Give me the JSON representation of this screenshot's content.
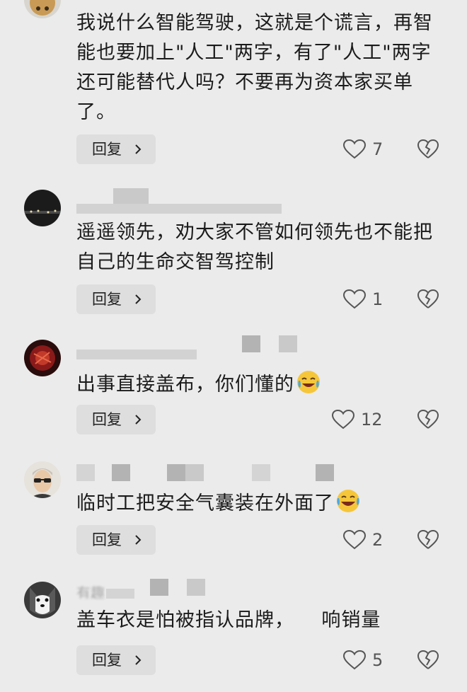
{
  "reply_label": "回复",
  "comments": [
    {
      "username": "",
      "text": "我说什么智能驾驶，这就是个谎言，再智能也要加上\"人工\"两字，有了\"人工\"两字还可能替代人吗？不要再为资本家买单了。",
      "likes": "7",
      "avatar": "bear-avatar-icon"
    },
    {
      "username": "",
      "text": "遥遥领先，劝大家不管如何领先也不能把自己的生命交智驾控制",
      "likes": "1",
      "avatar": "night-scene-avatar-icon"
    },
    {
      "username": "",
      "text": "出事直接盖布，你们懂的",
      "likes": "12",
      "avatar": "red-pattern-avatar-icon",
      "emoji": "laughing-crying-emoji-icon"
    },
    {
      "username": "",
      "text": "临时工把安全气囊装在外面了",
      "likes": "2",
      "avatar": "man-with-sunglasses-avatar-icon",
      "emoji": "tears-of-joy-emoji-icon"
    },
    {
      "username": "有趣",
      "text": "盖车衣是怕被指认品牌，    响销量",
      "likes": "5",
      "avatar": "husky-dog-avatar-icon"
    }
  ]
}
